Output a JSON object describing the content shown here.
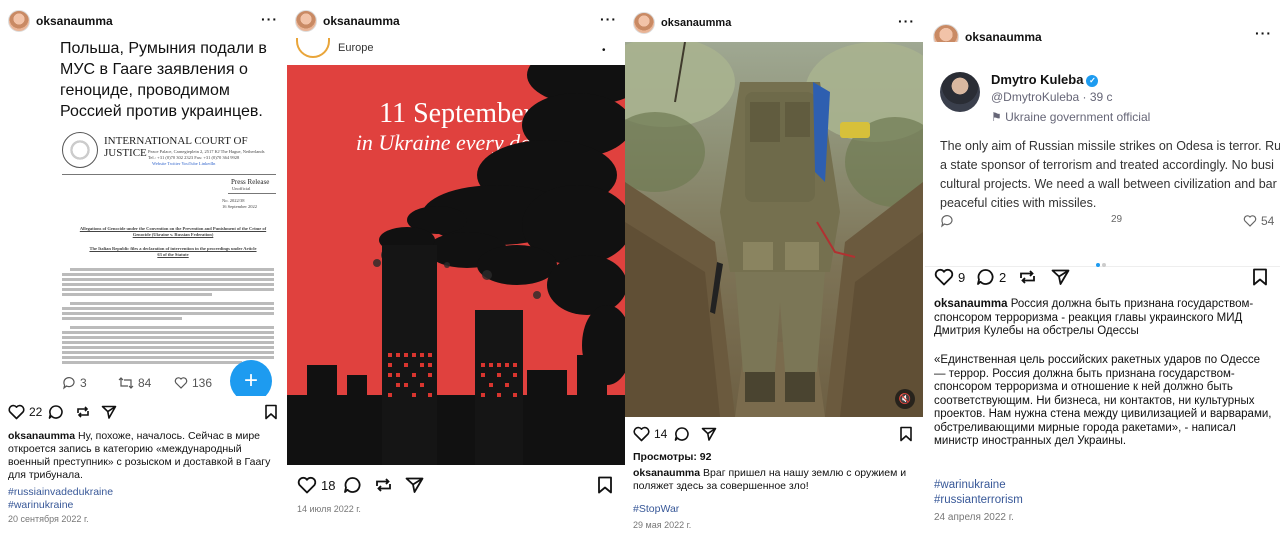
{
  "posts": [
    {
      "username": "oksanaumma",
      "more": "···",
      "doc_heading": "Польша, Румыния подали в МУС в Гааге заявления о геноциде, проводимом Россией против украинцев.",
      "icj_title": "INTERNATIONAL COURT OF JUSTICE",
      "icj_address": "Peace Palace, Carnegieplein 2, 2517 KJ The Hague, Netherlands",
      "icj_contacts": "Tel.: +31 (0)70 302 2323   Fax: +31 (0)70 364 9928",
      "icj_links": "Website   Twitter   YouTube   LinkedIn",
      "press_release": "Press Release",
      "unofficial": "Unofficial",
      "release_no": "No. 2022/38",
      "release_date": "16 September 2022",
      "allegations_title": "Allegations of Genocide under the Convention on the Prevention and Punishment of the Crime of Genocide (Ukraine v. Russian Federation)",
      "italian_title": "The Italian Republic files a declaration of intervention in the proceedings under Article 63 of the Statute",
      "tweet_stats": {
        "replies": "3",
        "retweets": "84",
        "likes": "136"
      },
      "likes": "22",
      "caption_user": "oksanaumma",
      "caption_text": "Ну, похоже, началось. Сейчас в мире откроется запись в категорию «международный военный преступник» с розыском и доставкой в Гаагу для трибунала.",
      "tags": [
        "#russiainvadedukraine",
        "#warinukraine"
      ],
      "date": "20 сентября 2022 г."
    },
    {
      "username": "oksanaumma",
      "more": "···",
      "source_label": "Europe",
      "image_title": "11 September",
      "image_subtitle": "in Ukraine every day...",
      "likes": "18",
      "date": "14 июля 2022 г."
    },
    {
      "username": "oksanaumma",
      "more": "···",
      "likes": "14",
      "views": "Просмотры: 92",
      "caption_user": "oksanaumma",
      "caption_text": "Враг пришел на нашу землю с оружием и поляжет здесь за совершенное зло!",
      "tags": [
        "#StopWar"
      ],
      "date": "29 мая 2022 г."
    },
    {
      "username": "oksanaumma",
      "more": "···",
      "tweet_name": "Dmytro Kuleba",
      "tweet_handle": "@DmytroKuleba · 39 с",
      "tweet_label": "Ukraine government official",
      "tweet_text_lines": [
        "The only aim of Russian missile strikes on Odesa is terror. Ru",
        "a state sponsor of terrorism and treated accordingly. No busi",
        "cultural projects. We need a wall between civilization and bar",
        "peaceful cities with missiles."
      ],
      "tweet_retweets": "29",
      "tweet_likes": "54",
      "likes": "9",
      "comments": "2",
      "caption_user": "oksanaumma",
      "caption_text": "Россия должна быть признана государством-спонсором терроризма - реакция главы украинского МИД Дмитрия Кулебы на обстрелы Одессы",
      "caption_quote": "«Единственная цель российских ракетных ударов по Одессе — террор. Россия должна быть признана государством-спонсором терроризма и отношение к ней должно быть соответствующим. Ни бизнеса, ни контактов, ни культурных проектов. Нам нужна стена между цивилизацией и варварами, обстреливающими мирные города ракетами», - написал министр иностранных дел Украины.",
      "tags": [
        "#warinukraine",
        "#russianterrorism"
      ],
      "date": "24 апреля 2022 г."
    }
  ],
  "colors": {
    "accent_blue": "#1d9bf0",
    "hashtag": "#385898",
    "poster_red": "#e0413e"
  }
}
